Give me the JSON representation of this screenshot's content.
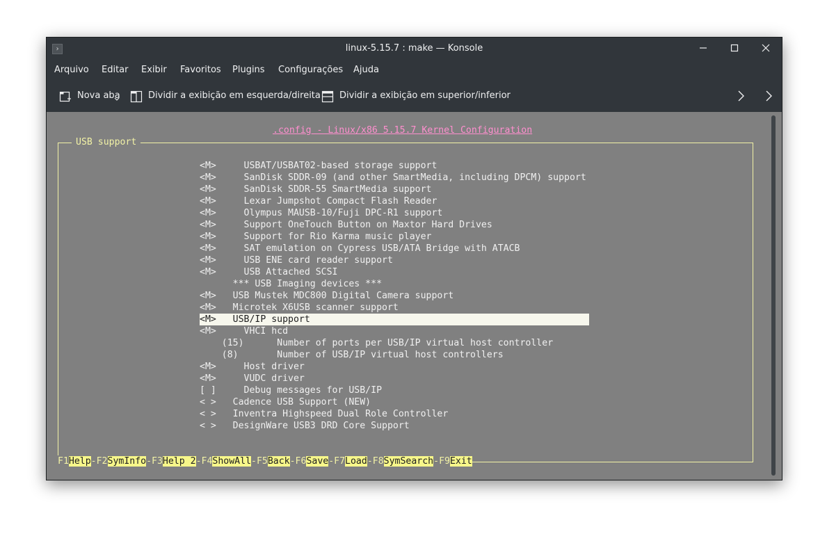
{
  "window": {
    "title": "linux-5.15.7 : make — Konsole",
    "app_icon": "terminal-icon",
    "controls": [
      "minimize-icon",
      "maximize-icon",
      "close-icon"
    ]
  },
  "menubar": [
    "Arquivo",
    "Editar",
    "Exibir",
    "Favoritos",
    "Plugins",
    "Configurações",
    "Ajuda"
  ],
  "toolbar": {
    "new_tab": "Nova aba",
    "split_lr": "Dividir a exibição em esquerda/direita",
    "split_tb": "Dividir a exibição em superior/inferior"
  },
  "terminal": {
    "config_title": ".config - Linux/x86 5.15.7 Kernel Configuration",
    "box_title": "USB support",
    "rows": [
      "<M>     USBAT/USBAT02-based storage support",
      "<M>     SanDisk SDDR-09 (and other SmartMedia, including DPCM) support",
      "<M>     SanDisk SDDR-55 SmartMedia support",
      "<M>     Lexar Jumpshot Compact Flash Reader",
      "<M>     Olympus MAUSB-10/Fuji DPC-R1 support",
      "<M>     Support OneTouch Button on Maxtor Hard Drives",
      "<M>     Support for Rio Karma music player",
      "<M>     SAT emulation on Cypress USB/ATA Bridge with ATACB",
      "<M>     USB ENE card reader support",
      "<M>     USB Attached SCSI",
      "      *** USB Imaging devices ***",
      "<M>   USB Mustek MDC800 Digital Camera support",
      "<M>   Microtek X6USB scanner support",
      "<M>   USB/IP support",
      "<M>     VHCI hcd",
      "    (15)      Number of ports per USB/IP virtual host controller",
      "    (8)       Number of USB/IP virtual host controllers",
      "<M>     Host driver",
      "<M>     VUDC driver",
      "[ ]     Debug messages for USB/IP",
      "< >   Cadence USB Support (NEW)",
      "< >   Inventra Highspeed Dual Role Controller",
      "< >   DesignWare USB3 DRD Core Support"
    ],
    "selected_row": "<M>   USB/IP support",
    "fkeys": [
      {
        "key": "F1",
        "name": "Help"
      },
      {
        "key": "F2",
        "name": "SymInfo"
      },
      {
        "key": "F3",
        "name": "Help 2"
      },
      {
        "key": "F4",
        "name": "ShowAll"
      },
      {
        "key": "F5",
        "name": "Back"
      },
      {
        "key": "F6",
        "name": "Save"
      },
      {
        "key": "F7",
        "name": "Load"
      },
      {
        "key": "F8",
        "name": "SymSearch"
      },
      {
        "key": "F9",
        "name": "Exit"
      }
    ]
  },
  "colors": {
    "chrome": "#31363b",
    "terminal_bg": "#808080",
    "terminal_fg": "#f0f0f0",
    "border_yellow": "#f2f2a6",
    "highlight": "#f7f7ed",
    "fkey_highlight": "#f7f78a",
    "config_title": "#ff8fcf"
  }
}
